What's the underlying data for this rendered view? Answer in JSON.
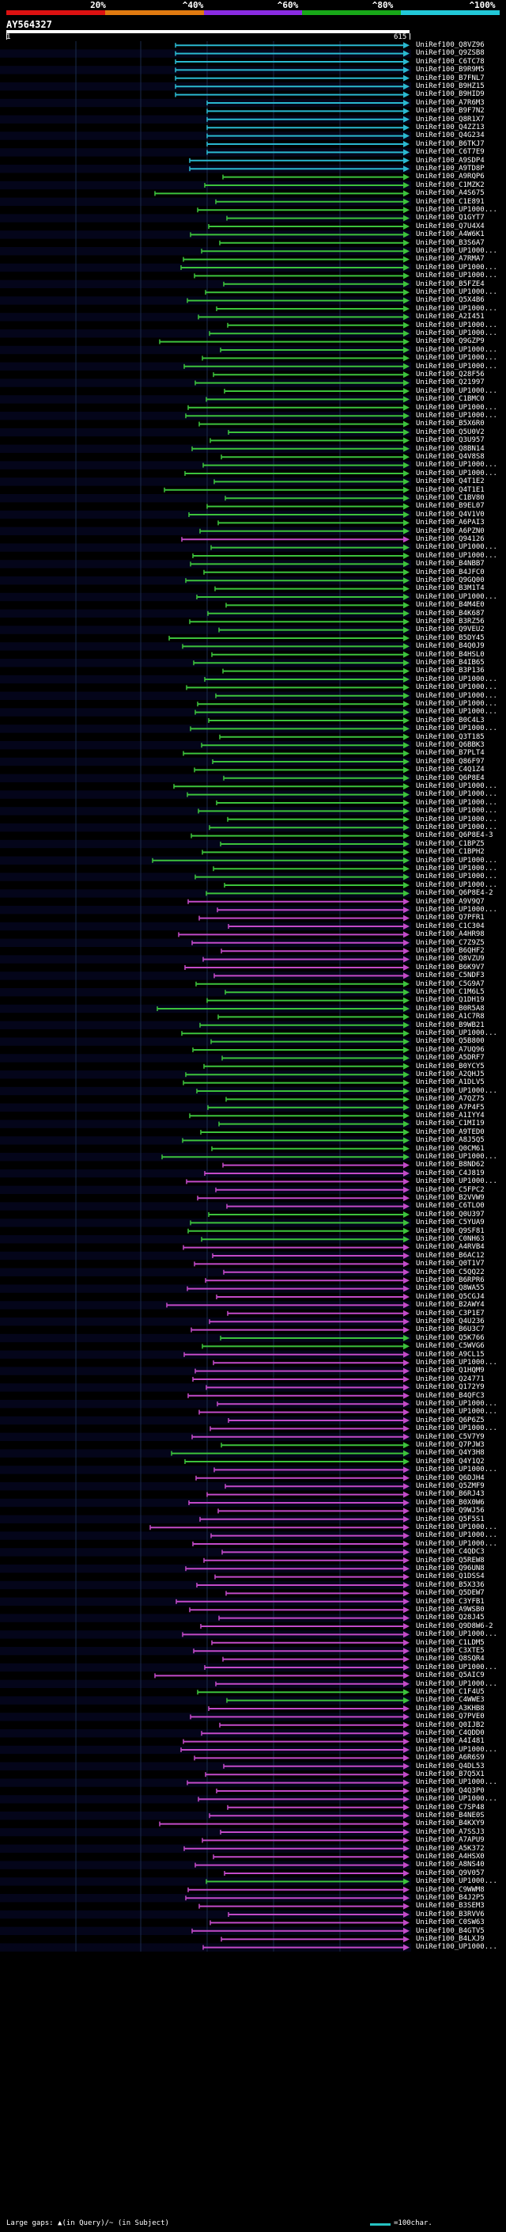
{
  "header": {
    "scale_labels": [
      "20%",
      "^40%",
      "^60%",
      "^80%",
      "^100%"
    ],
    "colorbar_colors": [
      "#dd1111",
      "#e07a10",
      "#8a2be2",
      "#18a818",
      "#22c8d8"
    ],
    "query_title": "AY564327",
    "query_start": "1",
    "query_end": "615"
  },
  "colors": {
    "cyan": "#2ab8d0",
    "green": "#3cc23c",
    "magenta": "#c24ac8",
    "row_band_a": "#000000",
    "row_band_b": "#04051a",
    "grid_line": "#1a2a4a"
  },
  "hits": [
    {
      "label": "UniRef100_Q8VZ96",
      "color": "cyan"
    },
    {
      "label": "UniRef100_Q9ZSB8",
      "color": "cyan"
    },
    {
      "label": "UniRef100_C6TC78",
      "color": "cyan"
    },
    {
      "label": "UniRef100_B9R9M5",
      "color": "cyan"
    },
    {
      "label": "UniRef100_B7FNL7",
      "color": "cyan"
    },
    {
      "label": "UniRef100_B9HZ15",
      "color": "cyan"
    },
    {
      "label": "UniRef100_B9HID9",
      "color": "cyan"
    },
    {
      "label": "UniRef100_A7R6M3",
      "color": "cyan"
    },
    {
      "label": "UniRef100_B9F7N2",
      "color": "cyan"
    },
    {
      "label": "UniRef100_Q8R1X7",
      "color": "cyan"
    },
    {
      "label": "UniRef100_Q4ZZ13",
      "color": "cyan"
    },
    {
      "label": "UniRef100_Q4G234",
      "color": "cyan"
    },
    {
      "label": "UniRef100_B6TKJ7",
      "color": "cyan"
    },
    {
      "label": "UniRef100_C6T7E9",
      "color": "cyan"
    },
    {
      "label": "UniRef100_A9SDP4",
      "color": "cyan"
    },
    {
      "label": "UniRef100_A9TD8P",
      "color": "cyan"
    },
    {
      "label": "UniRef100_A9RQP6",
      "color": "green"
    },
    {
      "label": "UniRef100_C1MZK2",
      "color": "green"
    },
    {
      "label": "UniRef100_A4S675",
      "color": "green"
    },
    {
      "label": "UniRef100_C1E891",
      "color": "green"
    },
    {
      "label": "UniRef100_UP1000...",
      "color": "green"
    },
    {
      "label": "UniRef100_Q1GYT7",
      "color": "green"
    },
    {
      "label": "UniRef100_Q7U4X4",
      "color": "green"
    },
    {
      "label": "UniRef100_A4W6K1",
      "color": "green"
    },
    {
      "label": "UniRef100_B3S6A7",
      "color": "green"
    },
    {
      "label": "UniRef100_UP1000...",
      "color": "green"
    },
    {
      "label": "UniRef100_A7RMA7",
      "color": "green"
    },
    {
      "label": "UniRef100_UP1000...",
      "color": "green"
    },
    {
      "label": "UniRef100_UP1000...",
      "color": "green"
    },
    {
      "label": "UniRef100_B5FZE4",
      "color": "green"
    },
    {
      "label": "UniRef100_UP1000...",
      "color": "green"
    },
    {
      "label": "UniRef100_Q5X4B6",
      "color": "green"
    },
    {
      "label": "UniRef100_UP1000...",
      "color": "green"
    },
    {
      "label": "UniRef100_A2I451",
      "color": "green"
    },
    {
      "label": "UniRef100_UP1000...",
      "color": "green"
    },
    {
      "label": "UniRef100_UP1000...",
      "color": "green"
    },
    {
      "label": "UniRef100_Q9GZP9",
      "color": "green"
    },
    {
      "label": "UniRef100_UP1000...",
      "color": "green"
    },
    {
      "label": "UniRef100_UP1000...",
      "color": "green"
    },
    {
      "label": "UniRef100_UP1000...",
      "color": "green"
    },
    {
      "label": "UniRef100_Q28F56",
      "color": "green"
    },
    {
      "label": "UniRef100_Q21997",
      "color": "green"
    },
    {
      "label": "UniRef100_UP1000...",
      "color": "green"
    },
    {
      "label": "UniRef100_C1BMC0",
      "color": "green"
    },
    {
      "label": "UniRef100_UP1000...",
      "color": "green"
    },
    {
      "label": "UniRef100_UP1000...",
      "color": "green"
    },
    {
      "label": "UniRef100_B5X6R0",
      "color": "green"
    },
    {
      "label": "UniRef100_Q5U0V2",
      "color": "green"
    },
    {
      "label": "UniRef100_Q3U957",
      "color": "green"
    },
    {
      "label": "UniRef100_Q8BN14",
      "color": "green"
    },
    {
      "label": "UniRef100_Q4V8S8",
      "color": "green"
    },
    {
      "label": "UniRef100_UP1000...",
      "color": "green"
    },
    {
      "label": "UniRef100_UP1000...",
      "color": "green"
    },
    {
      "label": "UniRef100_Q4T1E2",
      "color": "green"
    },
    {
      "label": "UniRef100_Q4T1E1",
      "color": "green"
    },
    {
      "label": "UniRef100_C1BV80",
      "color": "green"
    },
    {
      "label": "UniRef100_B9EL07",
      "color": "green"
    },
    {
      "label": "UniRef100_Q4V1V0",
      "color": "green"
    },
    {
      "label": "UniRef100_A6PAI3",
      "color": "green"
    },
    {
      "label": "UniRef100_A6PZN0",
      "color": "green"
    },
    {
      "label": "UniRef100_Q94126",
      "color": "magenta"
    },
    {
      "label": "UniRef100_UP1000...",
      "color": "green"
    },
    {
      "label": "UniRef100_UP1000...",
      "color": "green"
    },
    {
      "label": "UniRef100_B4NBB7",
      "color": "green"
    },
    {
      "label": "UniRef100_B4JFC0",
      "color": "green"
    },
    {
      "label": "UniRef100_Q9GQ00",
      "color": "green"
    },
    {
      "label": "UniRef100_B3M1T4",
      "color": "green"
    },
    {
      "label": "UniRef100_UP1000...",
      "color": "green"
    },
    {
      "label": "UniRef100_B4M4E0",
      "color": "green"
    },
    {
      "label": "UniRef100_B4K687",
      "color": "green"
    },
    {
      "label": "UniRef100_B3RZ56",
      "color": "green"
    },
    {
      "label": "UniRef100_Q9VEU2",
      "color": "green"
    },
    {
      "label": "UniRef100_B5DY45",
      "color": "green"
    },
    {
      "label": "UniRef100_B4Q0J9",
      "color": "green"
    },
    {
      "label": "UniRef100_B4HSL0",
      "color": "green"
    },
    {
      "label": "UniRef100_B4IB65",
      "color": "green"
    },
    {
      "label": "UniRef100_B3P136",
      "color": "green"
    },
    {
      "label": "UniRef100_UP1000...",
      "color": "green"
    },
    {
      "label": "UniRef100_UP1000...",
      "color": "green"
    },
    {
      "label": "UniRef100_UP1000...",
      "color": "green"
    },
    {
      "label": "UniRef100_UP1000...",
      "color": "green"
    },
    {
      "label": "UniRef100_UP1000...",
      "color": "green"
    },
    {
      "label": "UniRef100_B0C4L3",
      "color": "green"
    },
    {
      "label": "UniRef100_UP1000...",
      "color": "green"
    },
    {
      "label": "UniRef100_Q3T185",
      "color": "green"
    },
    {
      "label": "UniRef100_Q6BBK3",
      "color": "green"
    },
    {
      "label": "UniRef100_B7PLT4",
      "color": "green"
    },
    {
      "label": "UniRef100_Q86F97",
      "color": "green"
    },
    {
      "label": "UniRef100_C4Q1Z4",
      "color": "green"
    },
    {
      "label": "UniRef100_Q6P8E4",
      "color": "green"
    },
    {
      "label": "UniRef100_UP1000...",
      "color": "green"
    },
    {
      "label": "UniRef100_UP1000...",
      "color": "green"
    },
    {
      "label": "UniRef100_UP1000...",
      "color": "green"
    },
    {
      "label": "UniRef100_UP1000...",
      "color": "green"
    },
    {
      "label": "UniRef100_UP1000...",
      "color": "green"
    },
    {
      "label": "UniRef100_UP1000...",
      "color": "green"
    },
    {
      "label": "UniRef100_Q6P8E4-3",
      "color": "green"
    },
    {
      "label": "UniRef100_C1BPZ5",
      "color": "green"
    },
    {
      "label": "UniRef100_C1BPH2",
      "color": "green"
    },
    {
      "label": "UniRef100_UP1000...",
      "color": "green"
    },
    {
      "label": "UniRef100_UP1000...",
      "color": "green"
    },
    {
      "label": "UniRef100_UP1000...",
      "color": "green"
    },
    {
      "label": "UniRef100_UP1000...",
      "color": "green"
    },
    {
      "label": "UniRef100_Q6P8E4-2",
      "color": "green"
    },
    {
      "label": "UniRef100_A9V9Q7",
      "color": "magenta"
    },
    {
      "label": "UniRef100_UP1000...",
      "color": "magenta"
    },
    {
      "label": "UniRef100_Q7PFR1",
      "color": "magenta"
    },
    {
      "label": "UniRef100_C1C304",
      "color": "magenta"
    },
    {
      "label": "UniRef100_A4HR98",
      "color": "magenta"
    },
    {
      "label": "UniRef100_C7Z9Z5",
      "color": "magenta"
    },
    {
      "label": "UniRef100_B6QHF2",
      "color": "magenta"
    },
    {
      "label": "UniRef100_Q8VZU9",
      "color": "magenta"
    },
    {
      "label": "UniRef100_B6K9V7",
      "color": "magenta"
    },
    {
      "label": "UniRef100_C5NDF3",
      "color": "magenta"
    },
    {
      "label": "UniRef100_C5G9A7",
      "color": "green"
    },
    {
      "label": "UniRef100_C1M6L5",
      "color": "green"
    },
    {
      "label": "UniRef100_Q1DH19",
      "color": "green"
    },
    {
      "label": "UniRef100_B0R5A8",
      "color": "green"
    },
    {
      "label": "UniRef100_A1C7R8",
      "color": "green"
    },
    {
      "label": "UniRef100_B9WB21",
      "color": "green"
    },
    {
      "label": "UniRef100_UP1000...",
      "color": "green"
    },
    {
      "label": "UniRef100_Q5B800",
      "color": "green"
    },
    {
      "label": "UniRef100_A7UQ96",
      "color": "green"
    },
    {
      "label": "UniRef100_A5DRF7",
      "color": "green"
    },
    {
      "label": "UniRef100_B0YCY5",
      "color": "green"
    },
    {
      "label": "UniRef100_A2QHJ5",
      "color": "green"
    },
    {
      "label": "UniRef100_A1DLV5",
      "color": "green"
    },
    {
      "label": "UniRef100_UP1000...",
      "color": "green"
    },
    {
      "label": "UniRef100_A7QZ75",
      "color": "green"
    },
    {
      "label": "UniRef100_A7P4F5",
      "color": "green"
    },
    {
      "label": "UniRef100_A1IYY4",
      "color": "green"
    },
    {
      "label": "UniRef100_C1MI19",
      "color": "green"
    },
    {
      "label": "UniRef100_A9TED0",
      "color": "green"
    },
    {
      "label": "UniRef100_A8J5Q5",
      "color": "green"
    },
    {
      "label": "UniRef100_Q0CM61",
      "color": "green"
    },
    {
      "label": "UniRef100_UP1000...",
      "color": "green"
    },
    {
      "label": "UniRef100_B8ND62",
      "color": "magenta"
    },
    {
      "label": "UniRef100_C4J819",
      "color": "magenta"
    },
    {
      "label": "UniRef100_UP1000...",
      "color": "magenta"
    },
    {
      "label": "UniRef100_C5FPC2",
      "color": "magenta"
    },
    {
      "label": "UniRef100_B2VVW9",
      "color": "magenta"
    },
    {
      "label": "UniRef100_C6TLO0",
      "color": "magenta"
    },
    {
      "label": "UniRef100_Q0U397",
      "color": "green"
    },
    {
      "label": "UniRef100_C5YUA9",
      "color": "green"
    },
    {
      "label": "UniRef100_Q9SF81",
      "color": "green"
    },
    {
      "label": "UniRef100_C0NH63",
      "color": "green"
    },
    {
      "label": "UniRef100_A4RVB4",
      "color": "magenta"
    },
    {
      "label": "UniRef100_B6AC12",
      "color": "magenta"
    },
    {
      "label": "UniRef100_Q0T1V7",
      "color": "magenta"
    },
    {
      "label": "UniRef100_C5QQ22",
      "color": "magenta"
    },
    {
      "label": "UniRef100_B6RPR6",
      "color": "magenta"
    },
    {
      "label": "UniRef100_Q8WA55",
      "color": "magenta"
    },
    {
      "label": "UniRef100_Q5CGJ4",
      "color": "magenta"
    },
    {
      "label": "UniRef100_B2AWY4",
      "color": "magenta"
    },
    {
      "label": "UniRef100_C3P1E7",
      "color": "magenta"
    },
    {
      "label": "UniRef100_Q4U236",
      "color": "magenta"
    },
    {
      "label": "UniRef100_B6U3C7",
      "color": "magenta"
    },
    {
      "label": "UniRef100_Q5K766",
      "color": "green"
    },
    {
      "label": "UniRef100_C5WVG6",
      "color": "green"
    },
    {
      "label": "UniRef100_A9CL15",
      "color": "magenta"
    },
    {
      "label": "UniRef100_UP1000...",
      "color": "magenta"
    },
    {
      "label": "UniRef100_Q1HQM9",
      "color": "magenta"
    },
    {
      "label": "UniRef100_Q24771",
      "color": "magenta"
    },
    {
      "label": "UniRef100_Q172Y9",
      "color": "magenta"
    },
    {
      "label": "UniRef100_B4QFC3",
      "color": "magenta"
    },
    {
      "label": "UniRef100_UP1000...",
      "color": "magenta"
    },
    {
      "label": "UniRef100_UP1000...",
      "color": "magenta"
    },
    {
      "label": "UniRef100_Q6P6Z5",
      "color": "magenta"
    },
    {
      "label": "UniRef100_UP1000...",
      "color": "magenta"
    },
    {
      "label": "UniRef100_C5V7Y9",
      "color": "magenta"
    },
    {
      "label": "UniRef100_Q7PJW3",
      "color": "green"
    },
    {
      "label": "UniRef100_Q4Y3H8",
      "color": "green"
    },
    {
      "label": "UniRef100_Q4Y1Q2",
      "color": "green"
    },
    {
      "label": "UniRef100_UP1000...",
      "color": "magenta"
    },
    {
      "label": "UniRef100_Q6DJH4",
      "color": "magenta"
    },
    {
      "label": "UniRef100_Q5ZMF9",
      "color": "magenta"
    },
    {
      "label": "UniRef100_B6RJ43",
      "color": "magenta"
    },
    {
      "label": "UniRef100_B0X0W6",
      "color": "magenta"
    },
    {
      "label": "UniRef100_Q9WJ56",
      "color": "magenta"
    },
    {
      "label": "UniRef100_Q5F5S1",
      "color": "magenta"
    },
    {
      "label": "UniRef100_UP1000...",
      "color": "magenta"
    },
    {
      "label": "UniRef100_UP1000...",
      "color": "magenta"
    },
    {
      "label": "UniRef100_UP1000...",
      "color": "magenta"
    },
    {
      "label": "UniRef100_C4QDC3",
      "color": "magenta"
    },
    {
      "label": "UniRef100_Q5REW8",
      "color": "magenta"
    },
    {
      "label": "UniRef100_Q96UN8",
      "color": "magenta"
    },
    {
      "label": "UniRef100_Q1DSS4",
      "color": "magenta"
    },
    {
      "label": "UniRef100_B5X336",
      "color": "magenta"
    },
    {
      "label": "UniRef100_Q5DEW7",
      "color": "magenta"
    },
    {
      "label": "UniRef100_C3YFB1",
      "color": "magenta"
    },
    {
      "label": "UniRef100_A9WSB0",
      "color": "magenta"
    },
    {
      "label": "UniRef100_Q28J45",
      "color": "magenta"
    },
    {
      "label": "UniRef100_Q9D8W6-2",
      "color": "magenta"
    },
    {
      "label": "UniRef100_UP1000...",
      "color": "magenta"
    },
    {
      "label": "UniRef100_C1LDM5",
      "color": "magenta"
    },
    {
      "label": "UniRef100_C3XTE5",
      "color": "magenta"
    },
    {
      "label": "UniRef100_Q8SQR4",
      "color": "magenta"
    },
    {
      "label": "UniRef100_UP1000...",
      "color": "magenta"
    },
    {
      "label": "UniRef100_Q5AIC9",
      "color": "magenta"
    },
    {
      "label": "UniRef100_UP1000...",
      "color": "magenta"
    },
    {
      "label": "UniRef100_C1F4U5",
      "color": "green"
    },
    {
      "label": "UniRef100_C4WWE3",
      "color": "green"
    },
    {
      "label": "UniRef100_A3KHB8",
      "color": "magenta"
    },
    {
      "label": "UniRef100_Q7PVE0",
      "color": "magenta"
    },
    {
      "label": "UniRef100_Q0IJB2",
      "color": "magenta"
    },
    {
      "label": "UniRef100_C4QDD0",
      "color": "magenta"
    },
    {
      "label": "UniRef100_A4I481",
      "color": "magenta"
    },
    {
      "label": "UniRef100_UP1000...",
      "color": "magenta"
    },
    {
      "label": "UniRef100_A6R6S9",
      "color": "magenta"
    },
    {
      "label": "UniRef100_Q4DL53",
      "color": "magenta"
    },
    {
      "label": "UniRef100_B7Q5X1",
      "color": "magenta"
    },
    {
      "label": "UniRef100_UP1000...",
      "color": "magenta"
    },
    {
      "label": "UniRef100_Q4Q3P0",
      "color": "magenta"
    },
    {
      "label": "UniRef100_UP1000...",
      "color": "magenta"
    },
    {
      "label": "UniRef100_C7SP48",
      "color": "magenta"
    },
    {
      "label": "UniRef100_B4NE0S",
      "color": "magenta"
    },
    {
      "label": "UniRef100_B4KXY9",
      "color": "magenta"
    },
    {
      "label": "UniRef100_A7SSJ3",
      "color": "magenta"
    },
    {
      "label": "UniRef100_A7APU9",
      "color": "magenta"
    },
    {
      "label": "UniRef100_A5K372",
      "color": "magenta"
    },
    {
      "label": "UniRef100_A4HSX0",
      "color": "magenta"
    },
    {
      "label": "UniRef100_A8NS40",
      "color": "magenta"
    },
    {
      "label": "UniRef100_Q9V057",
      "color": "magenta"
    },
    {
      "label": "UniRef100_UP1000...",
      "color": "green"
    },
    {
      "label": "UniRef100_C9WWM8",
      "color": "magenta"
    },
    {
      "label": "UniRef100_B4J2P5",
      "color": "magenta"
    },
    {
      "label": "UniRef100_B3SEM3",
      "color": "magenta"
    },
    {
      "label": "UniRef100_B3RVV6",
      "color": "magenta"
    },
    {
      "label": "UniRef100_C0SW63",
      "color": "magenta"
    },
    {
      "label": "UniRef100_B4GTV5",
      "color": "magenta"
    },
    {
      "label": "UniRef100_B4LXJ9",
      "color": "magenta"
    },
    {
      "label": "UniRef100_UP1000...",
      "color": "magenta"
    }
  ],
  "legend": {
    "gaps_text": "Large gaps: ▲(in Query)/~ (in Subject)",
    "scale_text": "=100char."
  }
}
